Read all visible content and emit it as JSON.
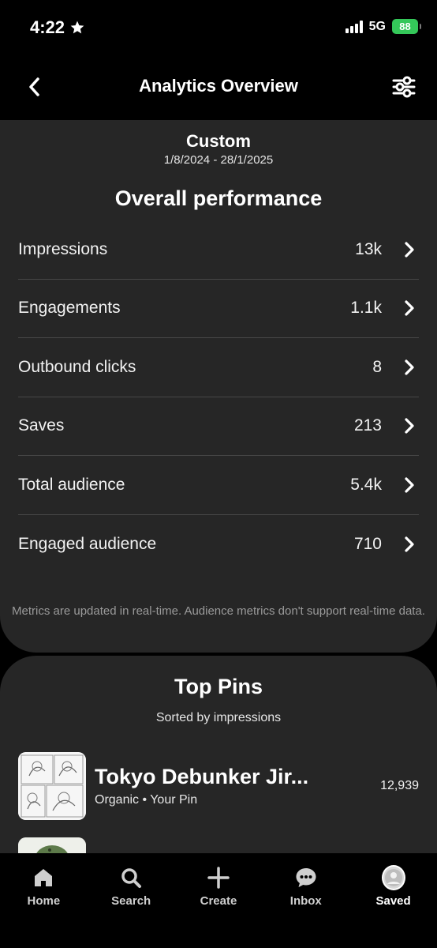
{
  "status": {
    "time": "4:22",
    "network": "5G",
    "battery": "88"
  },
  "header": {
    "title": "Analytics Overview"
  },
  "range": {
    "label": "Custom",
    "dates": "1/8/2024 - 28/1/2025"
  },
  "performance": {
    "title": "Overall performance",
    "metrics": [
      {
        "label": "Impressions",
        "value": "13k"
      },
      {
        "label": "Engagements",
        "value": "1.1k"
      },
      {
        "label": "Outbound clicks",
        "value": "8"
      },
      {
        "label": "Saves",
        "value": "213"
      },
      {
        "label": "Total audience",
        "value": "5.4k"
      },
      {
        "label": "Engaged audience",
        "value": "710"
      }
    ],
    "footnote": "Metrics are updated in real-time. Audience metrics don't support real-time data."
  },
  "top_pins": {
    "title": "Top Pins",
    "subtitle": "Sorted by impressions",
    "pins": [
      {
        "title": "Tokyo Debunker Jir...",
        "meta": "Organic • Your Pin",
        "count": "12,939"
      }
    ]
  },
  "tabs": [
    {
      "label": "Home",
      "icon": "home-icon"
    },
    {
      "label": "Search",
      "icon": "search-icon"
    },
    {
      "label": "Create",
      "icon": "plus-icon"
    },
    {
      "label": "Inbox",
      "icon": "chat-icon"
    },
    {
      "label": "Saved",
      "icon": "avatar"
    }
  ],
  "colors": {
    "card": "#262626",
    "battery": "#34c759",
    "background": "#000000"
  }
}
